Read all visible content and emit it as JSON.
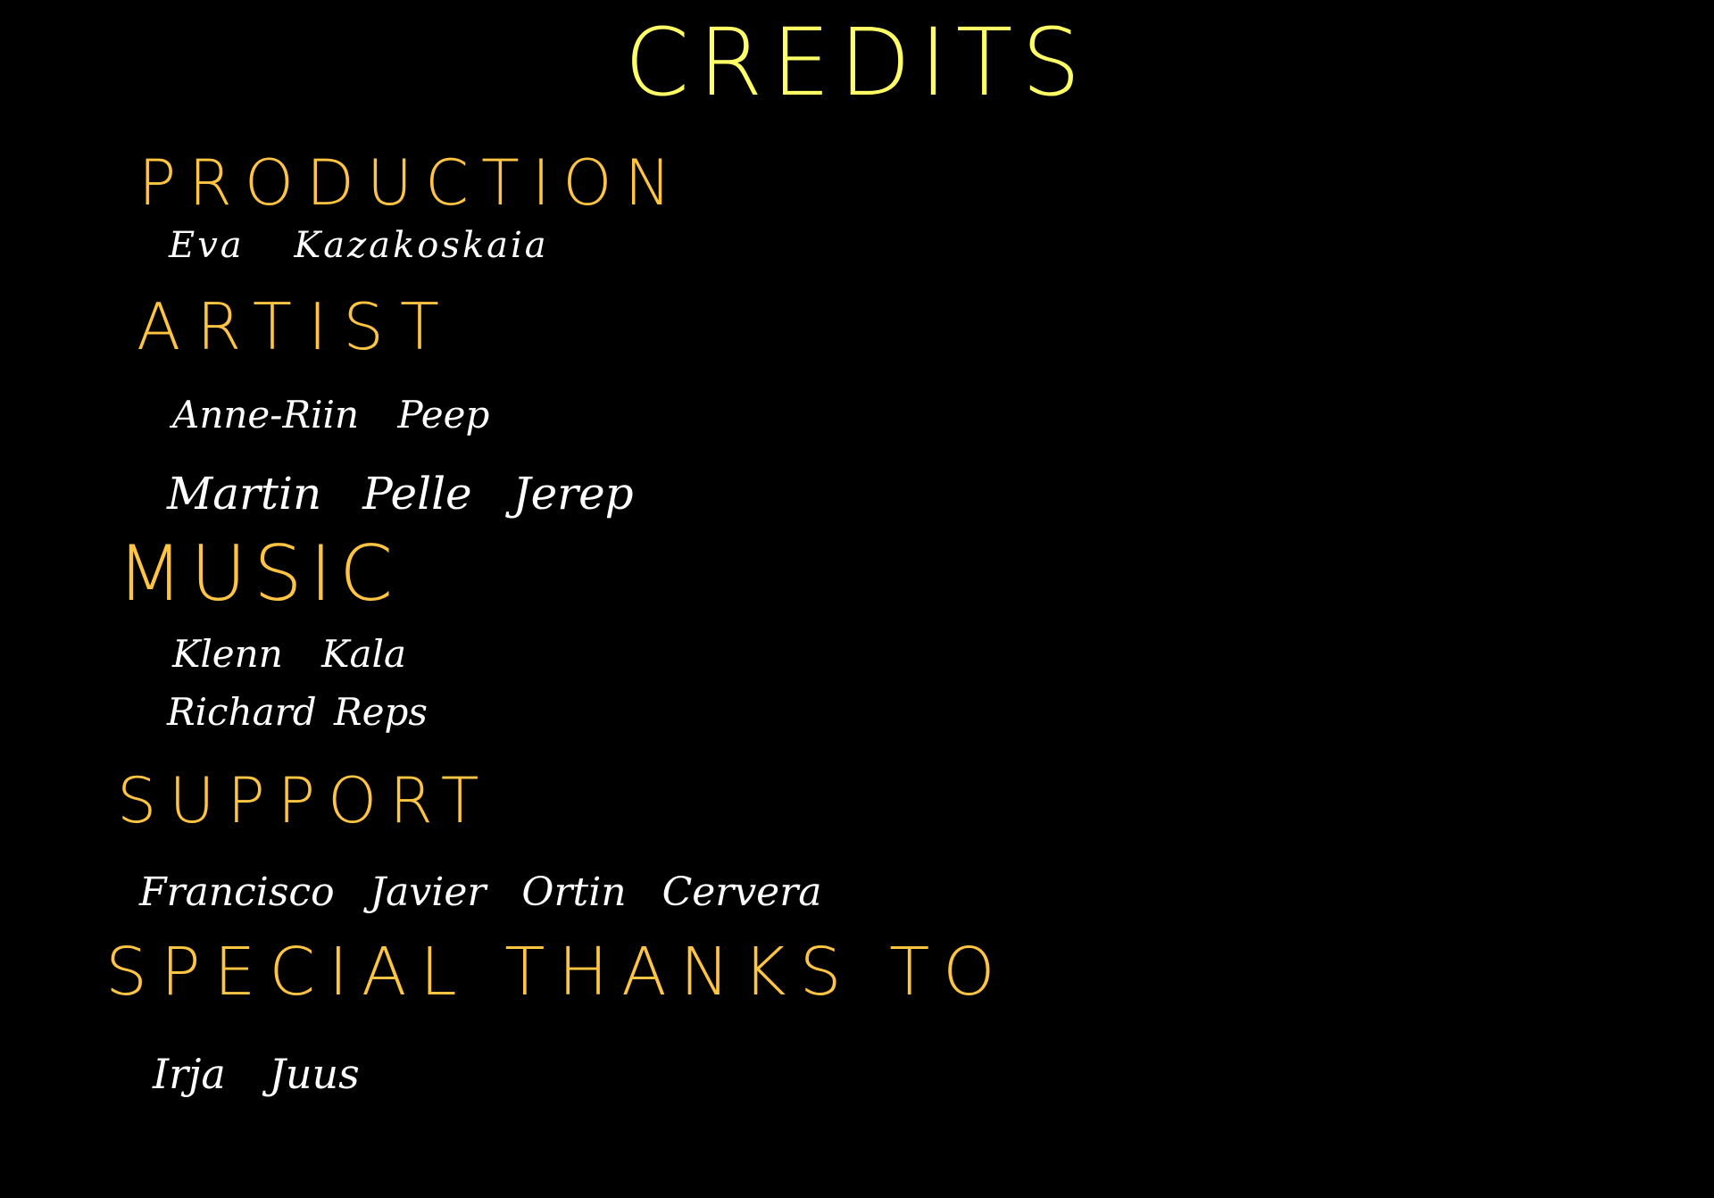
{
  "screen": {
    "title": "CREDITS"
  },
  "sections": {
    "production": {
      "heading": "PRODUCTION",
      "names": [
        "Eva Kazakoskaia"
      ]
    },
    "artist": {
      "heading": "ARTIST",
      "names": [
        "Anne-Riin Peep",
        "Martin Pelle Jerep"
      ]
    },
    "music": {
      "heading": "MUSIC",
      "names": [
        "Klenn Kala",
        "Richard Reps"
      ]
    },
    "support": {
      "heading": "SUPPORT",
      "names": [
        "Francisco Javier Ortin Cervera"
      ]
    },
    "special_thanks": {
      "heading": "SPECIAL THANKS TO",
      "names": [
        "Irja Juus"
      ]
    }
  },
  "colors": {
    "background": "#000000",
    "title": "#ffff66",
    "heading": "#ffc542",
    "name": "#ffffff"
  }
}
